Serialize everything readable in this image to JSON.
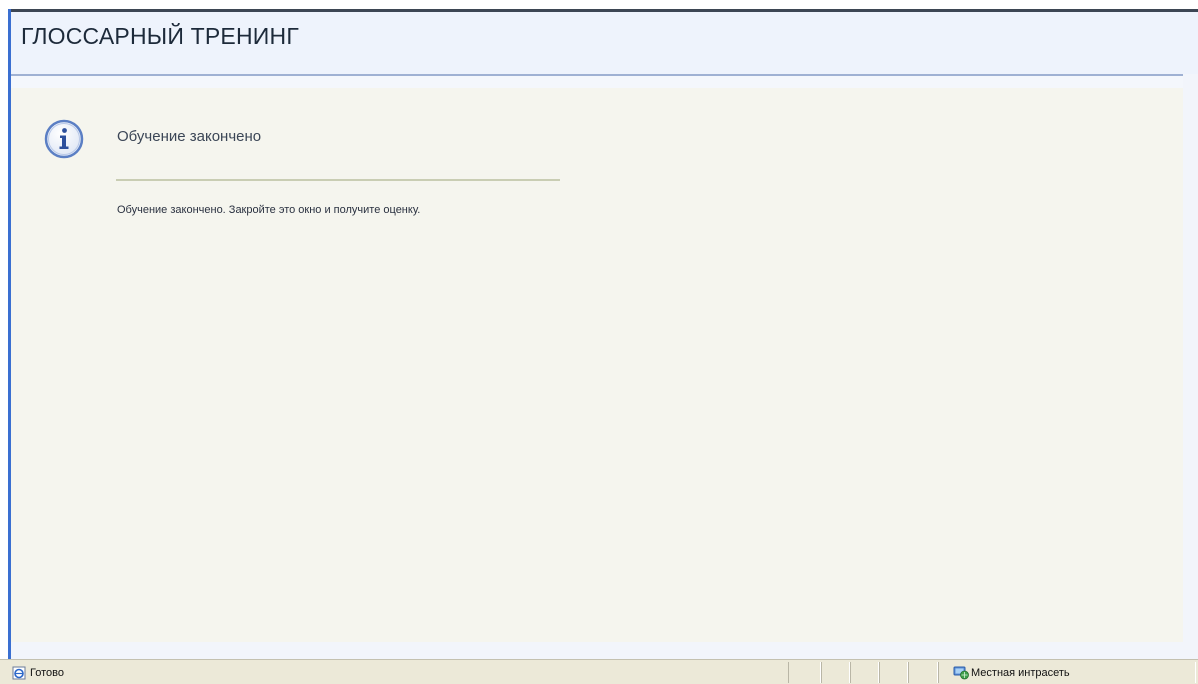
{
  "header": {
    "title": "ГЛОССАРНЫЙ ТРЕНИНГ"
  },
  "message": {
    "icon": "info-icon",
    "title": "Обучение закончено",
    "body": "Обучение закончено. Закройте это окно и получите оценку."
  },
  "statusbar": {
    "status_icon": "ie-page-icon",
    "status_text": "Готово",
    "zone_icon": "local-intranet-icon",
    "zone_text": "Местная интрасеть"
  },
  "colors": {
    "header_bg": "#eef3fc",
    "content_bg": "#f5f5ee",
    "statusbar_bg": "#ece9d8",
    "accent_blue": "#3a6fd1",
    "rule": "#c9cdb3"
  }
}
